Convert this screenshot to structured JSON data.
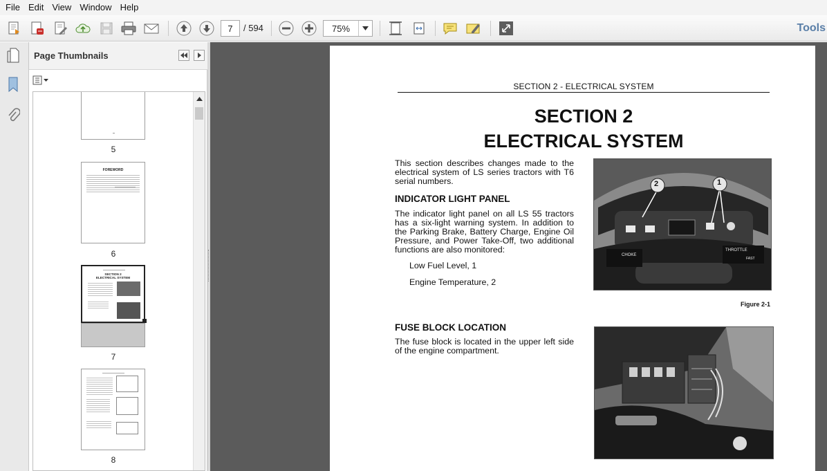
{
  "menu": [
    "File",
    "Edit",
    "View",
    "Window",
    "Help"
  ],
  "toolbar": {
    "current_page": "7",
    "page_total": "/ 594",
    "zoom": "75%",
    "tools_label": "Tools"
  },
  "thumbnails_panel": {
    "title": "Page Thumbnails",
    "pages": [
      {
        "label": "5"
      },
      {
        "label": "6",
        "heading": "FOREWORD"
      },
      {
        "label": "7",
        "heading_line1": "SECTION 2",
        "heading_line2": "ELECTRICAL SYSTEM",
        "selected": true
      },
      {
        "label": "8"
      }
    ]
  },
  "document": {
    "running_head": "SECTION 2 - ELECTRICAL SYSTEM",
    "title_line1": "SECTION 2",
    "title_line2": "ELECTRICAL SYSTEM",
    "intro": "This section describes changes made to the electrical system of LS series tractors with T6 serial numbers.",
    "indicator_heading": "INDICATOR LIGHT PANEL",
    "indicator_body": "The indicator light panel on all LS 55 tractors has a six-light warning system. In addition to the Parking Brake, Battery Charge, Engine Oil Pressure, and Power Take-Off, two additional functions are also monitored:",
    "list": [
      "Low Fuel Level, 1",
      "Engine Temperature, 2"
    ],
    "figure1_caption": "Figure 2-1",
    "figure1_callouts": [
      "1",
      "2"
    ],
    "figure1_labels": [
      "CHOKE",
      "THROTTLE",
      "FAST"
    ],
    "fuse_heading": "FUSE BLOCK LOCATION",
    "fuse_body": "The fuse block is located in the upper left side of the engine compartment."
  }
}
